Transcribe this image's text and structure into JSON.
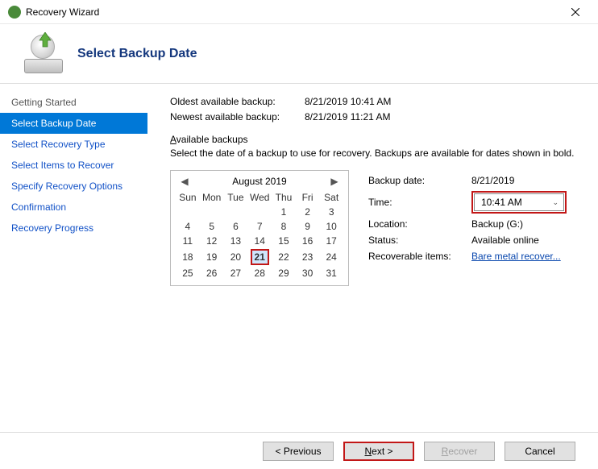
{
  "window": {
    "title": "Recovery Wizard"
  },
  "header": {
    "title": "Select Backup Date"
  },
  "sidebar": {
    "items": [
      {
        "label": "Getting Started",
        "gray": true
      },
      {
        "label": "Select Backup Date",
        "active": true
      },
      {
        "label": "Select Recovery Type"
      },
      {
        "label": "Select Items to Recover"
      },
      {
        "label": "Specify Recovery Options"
      },
      {
        "label": "Confirmation"
      },
      {
        "label": "Recovery Progress"
      }
    ]
  },
  "meta": {
    "oldest_label": "Oldest available backup:",
    "oldest_value": "8/21/2019 10:41 AM",
    "newest_label": "Newest available backup:",
    "newest_value": "8/21/2019 11:21 AM"
  },
  "section": {
    "title_u": "A",
    "title_rest": "vailable backups",
    "description": "Select the date of a backup to use for recovery. Backups are available for dates shown in bold."
  },
  "calendar": {
    "month": "August 2019",
    "dow": [
      "Sun",
      "Mon",
      "Tue",
      "Wed",
      "Thu",
      "Fri",
      "Sat"
    ],
    "weeks": [
      [
        "",
        "",
        "",
        "",
        "1",
        "2",
        "3"
      ],
      [
        "4",
        "5",
        "6",
        "7",
        "8",
        "9",
        "10"
      ],
      [
        "11",
        "12",
        "13",
        "14",
        "15",
        "16",
        "17"
      ],
      [
        "18",
        "19",
        "20",
        "21",
        "22",
        "23",
        "24"
      ],
      [
        "25",
        "26",
        "27",
        "28",
        "29",
        "30",
        "31"
      ]
    ],
    "selected": "21"
  },
  "info": {
    "date_label": "Backup date:",
    "date_value": "8/21/2019",
    "time_label": "Time:",
    "time_value": "10:41 AM",
    "location_label": "Location:",
    "location_value": "Backup (G:)",
    "status_label": "Status:",
    "status_value": "Available online",
    "items_label": "Recoverable items:",
    "items_value": "Bare metal recover..."
  },
  "buttons": {
    "previous": "< Previous",
    "next_u": "N",
    "next_rest": "ext >",
    "recover_u": "R",
    "recover_rest": "ecover",
    "cancel": "Cancel"
  }
}
